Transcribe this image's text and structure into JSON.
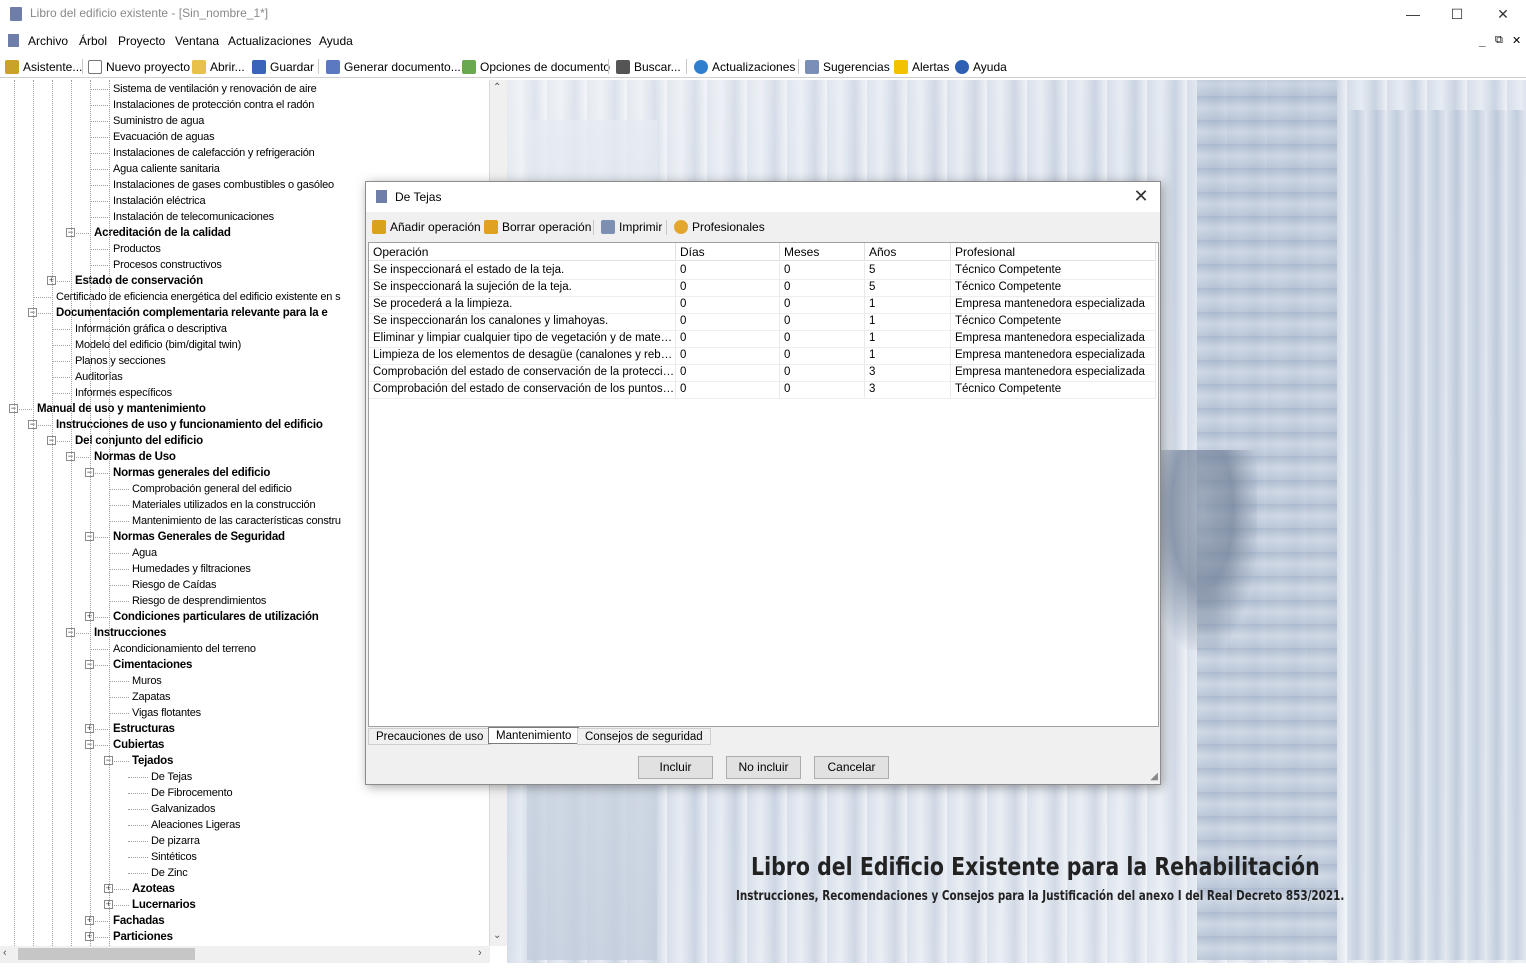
{
  "window": {
    "title": "Libro del edificio existente - [Sin_nombre_1*]",
    "minimize": "—",
    "maximize": "☐",
    "close": "✕"
  },
  "menu": {
    "items": [
      "Archivo",
      "Árbol",
      "Proyecto",
      "Ventana",
      "Actualizaciones",
      "Ayuda"
    ],
    "mdi_controls": [
      "_",
      "⧉",
      "✕"
    ]
  },
  "toolbar": {
    "items": [
      {
        "label": "Asistente...",
        "icon": "wand-icon",
        "color": "#c9a227"
      },
      {
        "label": "Nuevo proyecto",
        "icon": "new-file-icon",
        "color": "#ffffff"
      },
      {
        "label": "Abrir...",
        "icon": "folder-open-icon",
        "color": "#e8c14a"
      },
      {
        "label": "Guardar",
        "icon": "save-icon",
        "color": "#3a64b8"
      },
      {
        "label": "Generar documento...",
        "icon": "document-icon",
        "color": "#5b79c0"
      },
      {
        "label": "Opciones de documento",
        "icon": "document-options-icon",
        "color": "#6aa84f"
      },
      {
        "label": "Buscar...",
        "icon": "binoculars-icon",
        "color": "#555555"
      },
      {
        "label": "Actualizaciones",
        "icon": "globe-icon",
        "color": "#2f7fcf"
      },
      {
        "label": "Sugerencias",
        "icon": "suggestions-icon",
        "color": "#7a8fb8"
      },
      {
        "label": "Alertas",
        "icon": "warning-icon",
        "color": "#f2c200"
      },
      {
        "label": "Ayuda",
        "icon": "help-icon",
        "color": "#2d5fb3"
      }
    ]
  },
  "tree": {
    "nodes": [
      {
        "label": "Sistema de ventilación y renovación de aire",
        "level": 4,
        "bold": false,
        "expander": ""
      },
      {
        "label": "Instalaciones de protección contra el radón",
        "level": 4,
        "bold": false,
        "expander": ""
      },
      {
        "label": "Suministro de agua",
        "level": 4,
        "bold": false,
        "expander": ""
      },
      {
        "label": "Evacuación de aguas",
        "level": 4,
        "bold": false,
        "expander": ""
      },
      {
        "label": "Instalaciones de calefacción y refrigeración",
        "level": 4,
        "bold": false,
        "expander": ""
      },
      {
        "label": "Agua caliente sanitaria",
        "level": 4,
        "bold": false,
        "expander": ""
      },
      {
        "label": "Instalaciones de gases combustibles o gasóleo",
        "level": 4,
        "bold": false,
        "expander": ""
      },
      {
        "label": "Instalación eléctrica",
        "level": 4,
        "bold": false,
        "expander": ""
      },
      {
        "label": "Instalación de telecomunicaciones",
        "level": 4,
        "bold": false,
        "expander": ""
      },
      {
        "label": "Acreditación de la calidad",
        "level": 3,
        "bold": true,
        "expander": "−"
      },
      {
        "label": "Productos",
        "level": 4,
        "bold": false,
        "expander": ""
      },
      {
        "label": "Procesos constructivos",
        "level": 4,
        "bold": false,
        "expander": ""
      },
      {
        "label": "Estado de conservación",
        "level": 2,
        "bold": true,
        "expander": "+"
      },
      {
        "label": "Certificado de eficiencia energética del edificio existente en s",
        "level": 1,
        "bold": false,
        "expander": ""
      },
      {
        "label": "Documentación complementaria relevante para la e",
        "level": 1,
        "bold": true,
        "expander": "−"
      },
      {
        "label": "Información gráfica o descriptiva",
        "level": 2,
        "bold": false,
        "expander": ""
      },
      {
        "label": "Modelo del edificio (bim/digital twin)",
        "level": 2,
        "bold": false,
        "expander": ""
      },
      {
        "label": "Planos y secciones",
        "level": 2,
        "bold": false,
        "expander": ""
      },
      {
        "label": "Auditorías",
        "level": 2,
        "bold": false,
        "expander": ""
      },
      {
        "label": "Informes específicos",
        "level": 2,
        "bold": false,
        "expander": ""
      },
      {
        "label": "Manual de uso y mantenimiento",
        "level": 0,
        "bold": true,
        "expander": "−"
      },
      {
        "label": "Instrucciones de uso y funcionamiento del edificio",
        "level": 1,
        "bold": true,
        "expander": "−"
      },
      {
        "label": "Del conjunto del edificio",
        "level": 2,
        "bold": true,
        "expander": "−"
      },
      {
        "label": "Normas de Uso",
        "level": 3,
        "bold": true,
        "expander": "−"
      },
      {
        "label": "Normas generales del edificio",
        "level": 4,
        "bold": true,
        "expander": "−"
      },
      {
        "label": "Comprobación general del edificio",
        "level": 5,
        "bold": false,
        "expander": ""
      },
      {
        "label": "Materiales utilizados en la construcción",
        "level": 5,
        "bold": false,
        "expander": ""
      },
      {
        "label": "Mantenimiento de las características constru",
        "level": 5,
        "bold": false,
        "expander": ""
      },
      {
        "label": "Normas Generales de Seguridad",
        "level": 4,
        "bold": true,
        "expander": "−"
      },
      {
        "label": "Agua",
        "level": 5,
        "bold": false,
        "expander": ""
      },
      {
        "label": "Humedades y filtraciones",
        "level": 5,
        "bold": false,
        "expander": ""
      },
      {
        "label": "Riesgo de Caídas",
        "level": 5,
        "bold": false,
        "expander": ""
      },
      {
        "label": "Riesgo de desprendimientos",
        "level": 5,
        "bold": false,
        "expander": ""
      },
      {
        "label": "Condiciones particulares de utilización",
        "level": 4,
        "bold": true,
        "expander": "+"
      },
      {
        "label": "Instrucciones",
        "level": 3,
        "bold": true,
        "expander": "−"
      },
      {
        "label": "Acondicionamiento del terreno",
        "level": 4,
        "bold": false,
        "expander": ""
      },
      {
        "label": "Cimentaciones",
        "level": 4,
        "bold": true,
        "expander": "−"
      },
      {
        "label": "Muros",
        "level": 5,
        "bold": false,
        "expander": ""
      },
      {
        "label": "Zapatas",
        "level": 5,
        "bold": false,
        "expander": ""
      },
      {
        "label": "Vigas flotantes",
        "level": 5,
        "bold": false,
        "expander": ""
      },
      {
        "label": "Estructuras",
        "level": 4,
        "bold": true,
        "expander": "+"
      },
      {
        "label": "Cubiertas",
        "level": 4,
        "bold": true,
        "expander": "−"
      },
      {
        "label": "Tejados",
        "level": 5,
        "bold": true,
        "expander": "−"
      },
      {
        "label": "De Tejas",
        "level": 6,
        "bold": false,
        "expander": ""
      },
      {
        "label": "De Fibrocemento",
        "level": 6,
        "bold": false,
        "expander": ""
      },
      {
        "label": "Galvanizados",
        "level": 6,
        "bold": false,
        "expander": ""
      },
      {
        "label": "Aleaciones Ligeras",
        "level": 6,
        "bold": false,
        "expander": ""
      },
      {
        "label": "De pizarra",
        "level": 6,
        "bold": false,
        "expander": ""
      },
      {
        "label": "Sintéticos",
        "level": 6,
        "bold": false,
        "expander": ""
      },
      {
        "label": "De Zinc",
        "level": 6,
        "bold": false,
        "expander": ""
      },
      {
        "label": "Azoteas",
        "level": 5,
        "bold": true,
        "expander": "+"
      },
      {
        "label": "Lucernarios",
        "level": 5,
        "bold": true,
        "expander": "+"
      },
      {
        "label": "Fachadas",
        "level": 4,
        "bold": true,
        "expander": "+"
      },
      {
        "label": "Particiones",
        "level": 4,
        "bold": true,
        "expander": "+"
      }
    ]
  },
  "dialog": {
    "title": "De Tejas",
    "close": "✕",
    "tools": [
      {
        "label": "Añadir operación",
        "icon": "add-operation-icon",
        "color": "#d9a21b"
      },
      {
        "label": "Borrar operación",
        "icon": "delete-operation-icon",
        "color": "#e0a020"
      },
      {
        "label": "Imprimir",
        "icon": "print-icon",
        "color": "#7d8fb3"
      },
      {
        "label": "Profesionales",
        "icon": "user-icon",
        "color": "#e3a62f"
      }
    ],
    "grid": {
      "columns": [
        "Operación",
        "Días",
        "Meses",
        "Años",
        "Profesional"
      ],
      "rows": [
        [
          "Se inspeccionará el estado de la teja.",
          "0",
          "0",
          "5",
          "Técnico Competente"
        ],
        [
          "Se inspeccionará la sujeción de la teja.",
          "0",
          "0",
          "5",
          "Técnico Competente"
        ],
        [
          "Se procederá a la limpieza.",
          "0",
          "0",
          "1",
          "Empresa mantenedora especializada"
        ],
        [
          "Se inspeccionarán los canalones y limahoyas.",
          "0",
          "0",
          "1",
          "Técnico Competente"
        ],
        [
          "Eliminar y limpiar cualquier tipo de vegetación y de materi...",
          "0",
          "0",
          "1",
          "Empresa mantenedora especializada"
        ],
        [
          "Limpieza de los elementos de desagüe (canalones y rebos...",
          "0",
          "0",
          "1",
          "Empresa mantenedora especializada"
        ],
        [
          "Comprobación del estado de conservación de la protecció...",
          "0",
          "0",
          "3",
          "Empresa mantenedora especializada"
        ],
        [
          "Comprobación del estado de conservación de los puntos s...",
          "0",
          "0",
          "3",
          "Técnico Competente"
        ]
      ]
    },
    "tabs": [
      "Precauciones de uso",
      "Mantenimiento",
      "Consejos de seguridad"
    ],
    "active_tab": "Mantenimiento",
    "buttons": {
      "include": "Incluir",
      "exclude": "No incluir",
      "cancel": "Cancelar"
    }
  },
  "background": {
    "title": "Libro del Edificio Existente para la Rehabilitación",
    "subtitle": "Instrucciones, Recomendaciones y Consejos para la Justificación del anexo I del Real Decreto 853/2021."
  }
}
